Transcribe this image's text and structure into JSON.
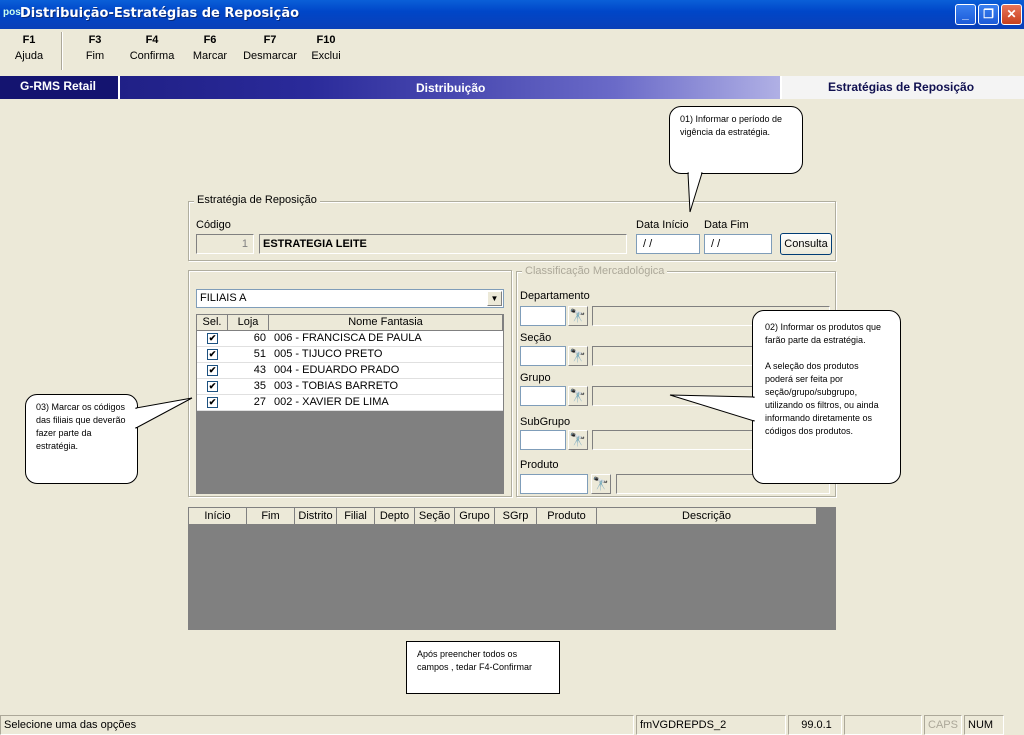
{
  "window": {
    "title": "Distribuição-Estratégias de Reposição",
    "icon_text": "pos"
  },
  "toolbar": [
    {
      "key": "F1",
      "label": "Ajuda"
    },
    {
      "key": "F3",
      "label": "Fim"
    },
    {
      "key": "F4",
      "label": "Confirma"
    },
    {
      "key": "F6",
      "label": "Marcar"
    },
    {
      "key": "F7",
      "label": "Desmarcar"
    },
    {
      "key": "F10",
      "label": "Exclui"
    }
  ],
  "band": {
    "left": "G-RMS Retail",
    "middle": "Distribuição",
    "right": "Estratégias de Reposição"
  },
  "estrategia": {
    "group_label": "Estratégia de Reposição",
    "codigo_label": "Código",
    "codigo_value": "1",
    "nome_value": "ESTRATEGIA LEITE",
    "data_inicio_label": "Data Início",
    "data_inicio_value": "/ /",
    "data_fim_label": "Data Fim",
    "data_fim_value": "/ /",
    "consulta_label": "Consulta"
  },
  "filiais": {
    "dropdown_value": "FILIAIS A",
    "columns": [
      "Sel.",
      "Loja",
      "Nome Fantasia"
    ],
    "rows": [
      {
        "loja": "60",
        "nome": "006 - FRANCISCA DE PAULA"
      },
      {
        "loja": "51",
        "nome": "005 - TIJUCO PRETO"
      },
      {
        "loja": "43",
        "nome": "004 - EDUARDO PRADO"
      },
      {
        "loja": "35",
        "nome": "003 - TOBIAS BARRETO"
      },
      {
        "loja": "27",
        "nome": "002 - XAVIER DE LIMA"
      }
    ]
  },
  "classificacao": {
    "group_label": "Classificação Mercadológica",
    "departamento": "Departamento",
    "secao": "Seção",
    "grupo": "Grupo",
    "subgrupo": "SubGrupo",
    "produto": "Produto"
  },
  "bottom_grid": {
    "columns": [
      "Início",
      "Fim",
      "Distrito",
      "Filial",
      "Depto",
      "Seção",
      "Grupo",
      "SGrp",
      "Produto",
      "Descrição"
    ]
  },
  "callouts": {
    "c1": "01) Informar o período de vigência da estratégia.",
    "c2a": "02) Informar os produtos que farão parte da estratégia.",
    "c2b": "A seleção dos produtos poderá ser feita por seção/grupo/subgrupo, utilizando os filtros, ou ainda informando diretamente os códigos dos produtos.",
    "c3": "03) Marcar os códigos das filiais que deverão fazer parte da estratégia.",
    "c4": "Após preencher todos os campos , tedar F4-Confirmar"
  },
  "status": {
    "message": "Selecione uma das opções",
    "form": "fmVGDREPDS_2",
    "version": "99.0.1",
    "blank": "",
    "caps": "CAPS",
    "num": "NUM"
  }
}
